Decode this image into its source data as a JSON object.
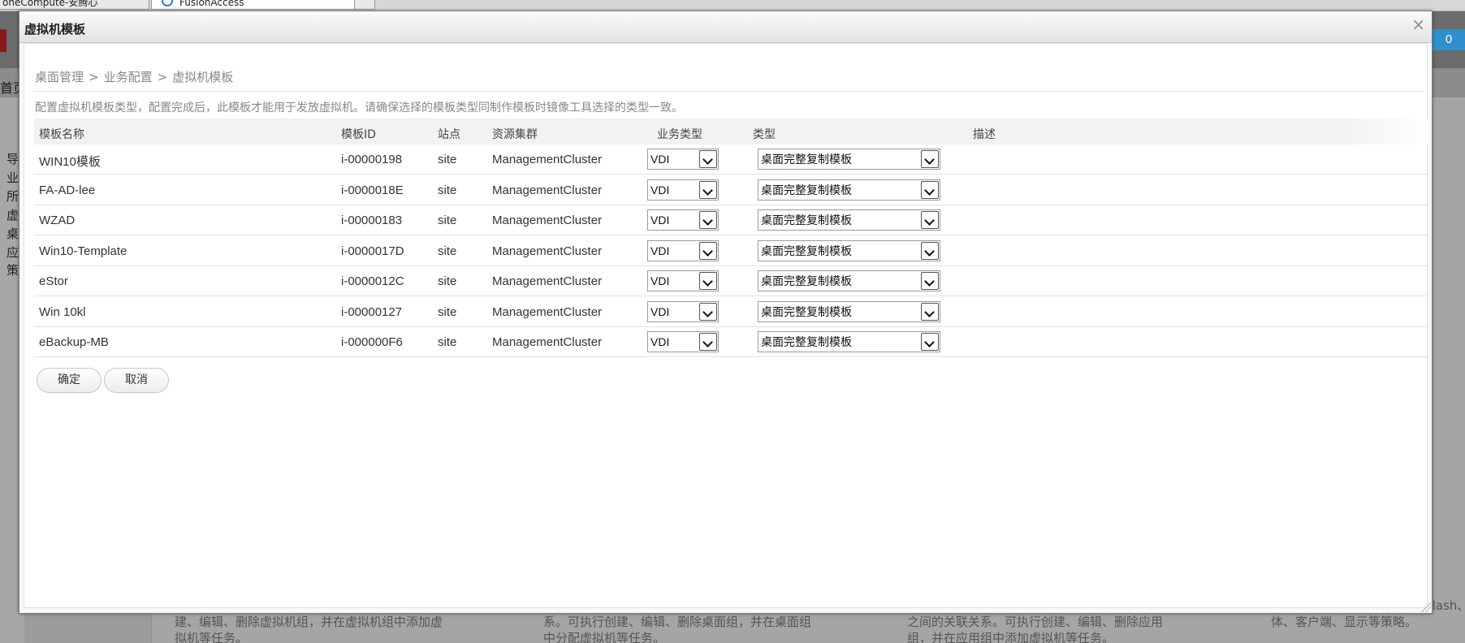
{
  "browser": {
    "tabs": [
      {
        "label": "oneCompute-安腾心"
      },
      {
        "label": "FusionAccess"
      }
    ]
  },
  "background": {
    "badge_count": "0",
    "nav_home": "首页",
    "side_items": [
      "导",
      "业",
      "所",
      "虚",
      "桌",
      "应",
      "策"
    ],
    "texts": [
      "建、编辑、删除虚拟机组，并在虚拟机组中添加虚拟机等任务。",
      "系。可执行创建、编辑、删除桌面组，并在桌面组中分配虚拟机等任务。",
      "之间的关联关系。可执行创建、编辑、删除应用组，并在应用组中添加虚拟机等任务。",
      "体、客户端、显示等策略。"
    ],
    "flash_text": "Flash、"
  },
  "dialog": {
    "title": "虚拟机模板",
    "close_symbol": "×",
    "breadcrumb": [
      "桌面管理",
      "业务配置",
      "虚拟机模板"
    ],
    "breadcrumb_separator": ">",
    "hint": "配置虚拟机模板类型，配置完成后，此模板才能用于发放虚拟机。请确保选择的模板类型同制作模板时镜像工具选择的类型一致。",
    "columns": {
      "name": "模板名称",
      "id": "模板ID",
      "site": "站点",
      "cluster": "资源集群",
      "biz_type": "业务类型",
      "type": "类型",
      "desc": "描述"
    },
    "rows": [
      {
        "name": "WIN10模板",
        "id": "i-00000198",
        "site": "site",
        "cluster": "ManagementCluster",
        "biz_type": "VDI",
        "type": "桌面完整复制模板",
        "desc": ""
      },
      {
        "name": "FA-AD-lee",
        "id": "i-0000018E",
        "site": "site",
        "cluster": "ManagementCluster",
        "biz_type": "VDI",
        "type": "桌面完整复制模板",
        "desc": ""
      },
      {
        "name": "WZAD",
        "id": "i-00000183",
        "site": "site",
        "cluster": "ManagementCluster",
        "biz_type": "VDI",
        "type": "桌面完整复制模板",
        "desc": ""
      },
      {
        "name": "Win10-Template",
        "id": "i-0000017D",
        "site": "site",
        "cluster": "ManagementCluster",
        "biz_type": "VDI",
        "type": "桌面完整复制模板",
        "desc": ""
      },
      {
        "name": "eStor",
        "id": "i-0000012C",
        "site": "site",
        "cluster": "ManagementCluster",
        "biz_type": "VDI",
        "type": "桌面完整复制模板",
        "desc": ""
      },
      {
        "name": "Win 10kl",
        "id": "i-00000127",
        "site": "site",
        "cluster": "ManagementCluster",
        "biz_type": "VDI",
        "type": "桌面完整复制模板",
        "desc": ""
      },
      {
        "name": "eBackup-MB",
        "id": "i-000000F6",
        "site": "site",
        "cluster": "ManagementCluster",
        "biz_type": "VDI",
        "type": "桌面完整复制模板",
        "desc": ""
      }
    ],
    "buttons": {
      "ok": "确定",
      "cancel": "取消"
    }
  }
}
